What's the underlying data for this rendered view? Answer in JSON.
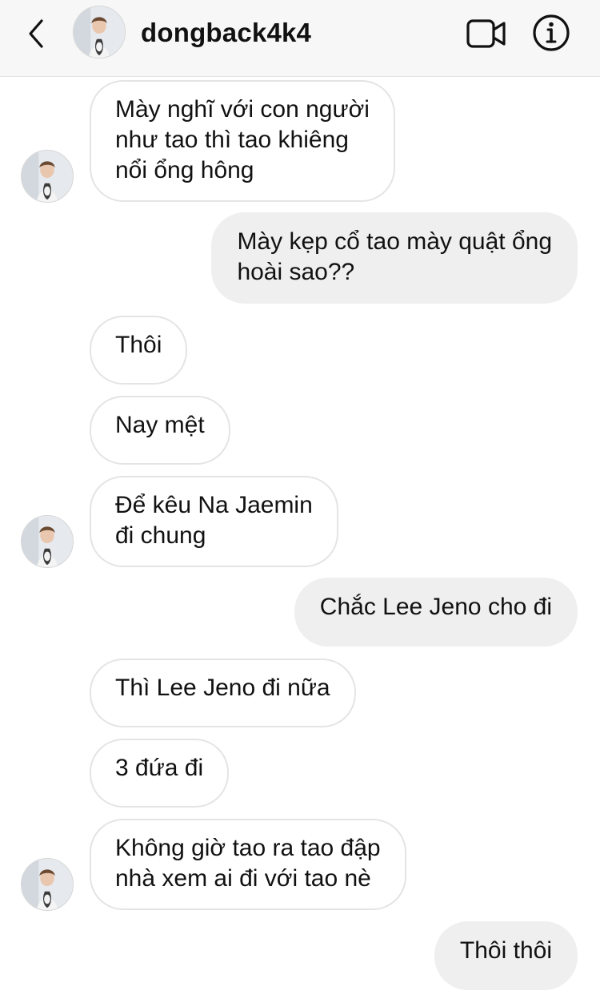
{
  "header": {
    "username": "dongback4k4",
    "back_icon": "chevron-left-icon",
    "video_icon": "video-call-icon",
    "info_icon": "info-icon"
  },
  "colors": {
    "header_bg": "#f7f7f7",
    "incoming_bubble_bg": "#ffffff",
    "incoming_bubble_border": "#e4e4e4",
    "outgoing_bubble_bg": "#efefef",
    "text": "#111111"
  },
  "messages": [
    {
      "direction": "incoming",
      "lines": [
        "Mày nghĩ với con người",
        "như tao thì tao khiêng",
        "nổi ổng hông"
      ]
    },
    {
      "direction": "outgoing",
      "lines": [
        "Mày kẹp cổ tao mày quật ổng",
        "hoài sao??"
      ]
    },
    {
      "direction": "incoming",
      "lines": [
        "Thôi"
      ]
    },
    {
      "direction": "incoming",
      "lines": [
        "Nay mệt"
      ]
    },
    {
      "direction": "incoming",
      "lines": [
        "Để kêu Na Jaemin",
        "đi chung"
      ]
    },
    {
      "direction": "outgoing",
      "lines": [
        "Chắc Lee Jeno cho đi"
      ]
    },
    {
      "direction": "incoming",
      "lines": [
        "Thì Lee Jeno đi nữa"
      ]
    },
    {
      "direction": "incoming",
      "lines": [
        "3 đứa đi"
      ]
    },
    {
      "direction": "incoming",
      "lines": [
        "Không giờ tao ra tao đập",
        "nhà xem ai đi với tao nè"
      ]
    },
    {
      "direction": "outgoing",
      "lines": [
        "Thôi thôi"
      ]
    }
  ]
}
